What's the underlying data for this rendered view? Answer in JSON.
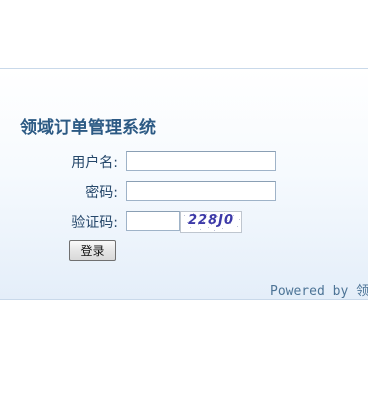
{
  "login": {
    "title": "领域订单管理系统",
    "username_label": "用户名:",
    "username_value": "",
    "password_label": "密码:",
    "password_value": "",
    "captcha_label": "验证码:",
    "captcha_value": "",
    "captcha_image_text": "228J0",
    "login_button": "登录",
    "footer": "Powered by 领"
  }
}
